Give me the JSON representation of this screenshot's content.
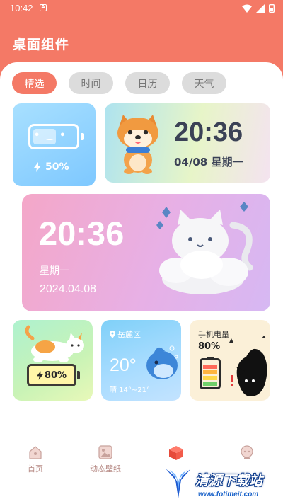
{
  "status_bar": {
    "time": "10:42",
    "notification_letter": "A"
  },
  "page_title": "桌面组件",
  "tabs": [
    {
      "label": "精选",
      "active": true
    },
    {
      "label": "时间",
      "active": false
    },
    {
      "label": "日历",
      "active": false
    },
    {
      "label": "天气",
      "active": false
    }
  ],
  "widgets": {
    "battery": {
      "face": "• ‿ •",
      "percent": "50%",
      "level": 0.5
    },
    "dog_clock": {
      "time": "20:36",
      "date": "04/08  星期一"
    },
    "cat_clock": {
      "time": "20:36",
      "weekday": "星期一",
      "date": "2024.04.08"
    },
    "shiba_battery": {
      "percent": "80%",
      "level": 0.8
    },
    "weather": {
      "location": "岳麓区",
      "temperature": "20°",
      "description": "晴 14°~21°"
    },
    "phone_battery": {
      "title": "手机电量",
      "percent": "80%",
      "level": 0.8
    }
  },
  "bottom_nav": [
    {
      "label": "首页"
    },
    {
      "label": "动态壁纸"
    },
    {
      "label": ""
    },
    {
      "label": ""
    }
  ],
  "watermark": {
    "title": "清源下载站",
    "url": "www.fotimeit.com"
  },
  "colors": {
    "accent": "#f47966",
    "tab_inactive": "#dcdcdc",
    "nav_text": "#b78b86"
  }
}
